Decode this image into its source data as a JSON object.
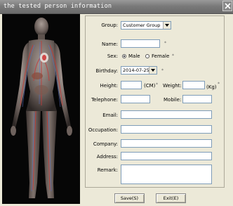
{
  "window": {
    "title": "the tested person information",
    "close_glyph": "×"
  },
  "form": {
    "group": {
      "label": "Group:",
      "value": "Customer Group"
    },
    "name": {
      "label": "Name:",
      "value": "",
      "required": "*"
    },
    "sex": {
      "label": "Sex:",
      "options": [
        "Male",
        "Female"
      ],
      "selected": "Male",
      "required": "*"
    },
    "birthday": {
      "label": "Birthday:",
      "value": "2014-07-25",
      "required": "*"
    },
    "height": {
      "label": "Height:",
      "value": "",
      "unit": "(CM)",
      "required": "*"
    },
    "weight": {
      "label": "Weight:",
      "value": "",
      "unit": "(Kg)",
      "required": "*"
    },
    "telephone": {
      "label": "Telephone:",
      "value": ""
    },
    "mobile": {
      "label": "Mobile:",
      "value": ""
    },
    "email": {
      "label": "Email:",
      "value": ""
    },
    "occupation": {
      "label": "Occupation:",
      "value": ""
    },
    "company": {
      "label": "Company:",
      "value": ""
    },
    "address": {
      "label": "Address:",
      "value": ""
    },
    "remark": {
      "label": "Remark:",
      "value": ""
    }
  },
  "buttons": {
    "save": "Save(S)",
    "exit": "Exit(E)"
  },
  "icons": {
    "close": "close-icon",
    "dropdown": "chevron-down-icon",
    "illustration": "human-anatomy-figure"
  }
}
